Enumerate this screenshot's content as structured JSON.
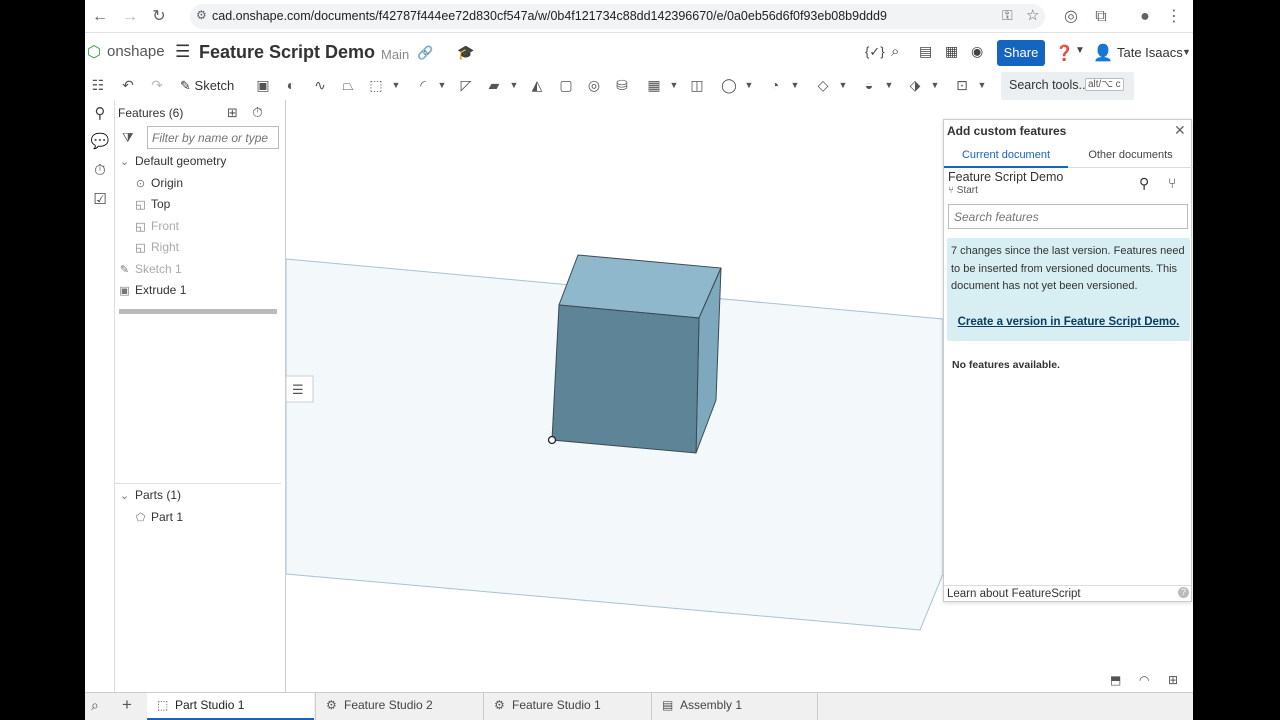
{
  "browser": {
    "url": "cad.onshape.com/documents/f42787f444ee72d830cf547a/w/0b4f121734c88dd142396670/e/0a0eb56d6f0f93eb08b9ddd9"
  },
  "header": {
    "logo": "onshape",
    "doc_title": "Feature Script Demo",
    "branch": "Main",
    "share_label": "Share",
    "user_name": "Tate Isaacs"
  },
  "toolbar": {
    "sketch_label": "Sketch",
    "search_label": "Search tools...",
    "search_shortcut": "alt/⌥  c"
  },
  "feature_list": {
    "header": "Features (6)",
    "filter_placeholder": "Filter by name or type",
    "default_geometry": "Default geometry",
    "origin": "Origin",
    "top": "Top",
    "front": "Front",
    "right": "Right",
    "sketch1": "Sketch 1",
    "extrude1": "Extrude 1",
    "parts_header": "Parts (1)",
    "part1": "Part 1"
  },
  "custom_features": {
    "title": "Add custom features",
    "tab_current": "Current document",
    "tab_other": "Other documents",
    "doc_name": "Feature Script Demo",
    "branch": "Start",
    "search_placeholder": "Search features",
    "info_text": "7 changes since the last version. Features need to be inserted from versioned documents. This document has not yet been versioned.",
    "info_link": "Create a version in Feature Script Demo.",
    "empty_text": "No features available.",
    "learn_link": "Learn about FeatureScript"
  },
  "tabs": [
    {
      "label": "Part Studio 1"
    },
    {
      "label": "Feature Studio 2"
    },
    {
      "label": "Feature Studio 1"
    },
    {
      "label": "Assembly 1"
    }
  ],
  "colors": {
    "accent": "#1565c0",
    "cube_top": "#8fb8cc",
    "cube_front": "#5d8597",
    "cube_side": "#7ea8bc",
    "plane": "#f3f8fa",
    "info_bg": "#d7eef3"
  }
}
